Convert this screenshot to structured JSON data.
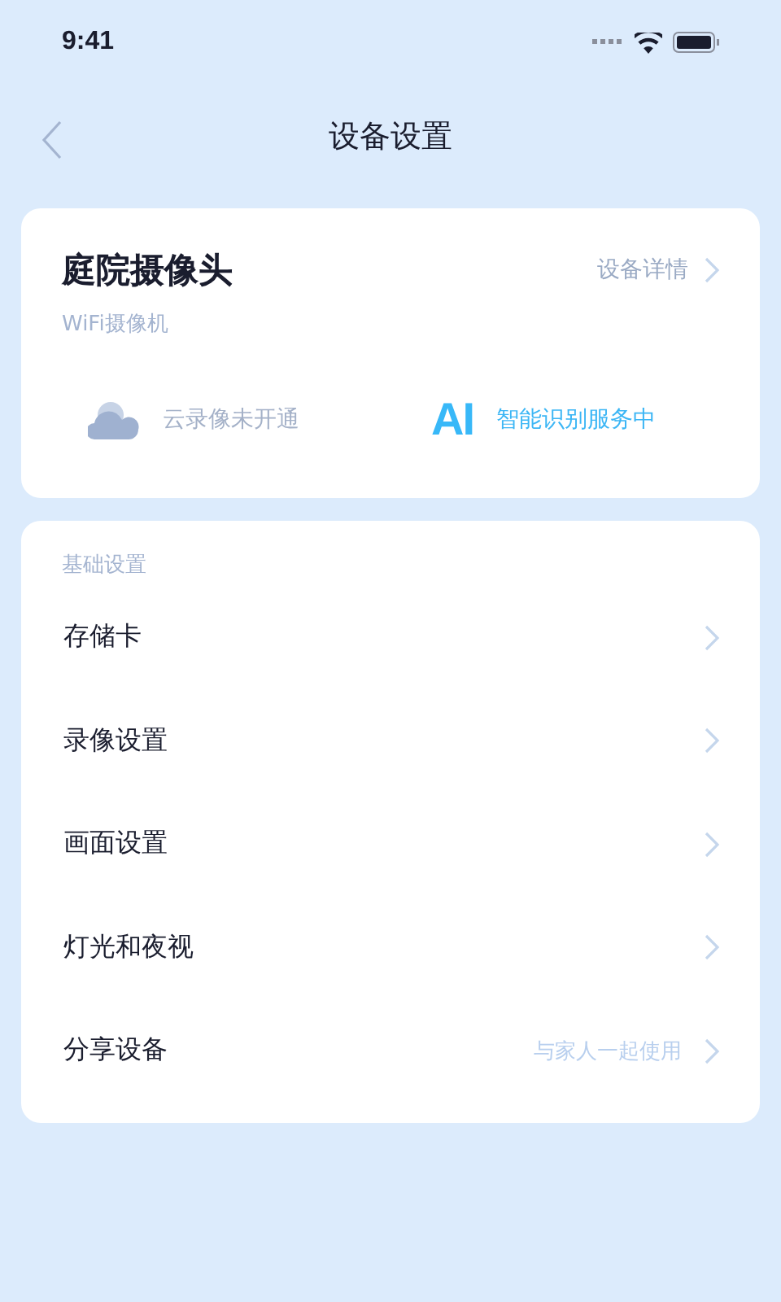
{
  "status_bar": {
    "time": "9:41"
  },
  "nav": {
    "title": "设备设置"
  },
  "device": {
    "name": "庭院摄像头",
    "details_link": "设备详情",
    "type": "WiFi摄像机",
    "services": [
      {
        "kind": "cloud",
        "text": "云录像未开通",
        "active": false
      },
      {
        "kind": "ai",
        "badge": "AI",
        "text": "智能识别服务中",
        "active": true
      }
    ]
  },
  "settings": {
    "section_title": "基础设置",
    "items": [
      {
        "label": "存储卡"
      },
      {
        "label": "录像设置"
      },
      {
        "label": "画面设置"
      },
      {
        "label": "灯光和夜视"
      },
      {
        "label": "分享设备",
        "hint": "与家人一起使用"
      }
    ]
  }
}
